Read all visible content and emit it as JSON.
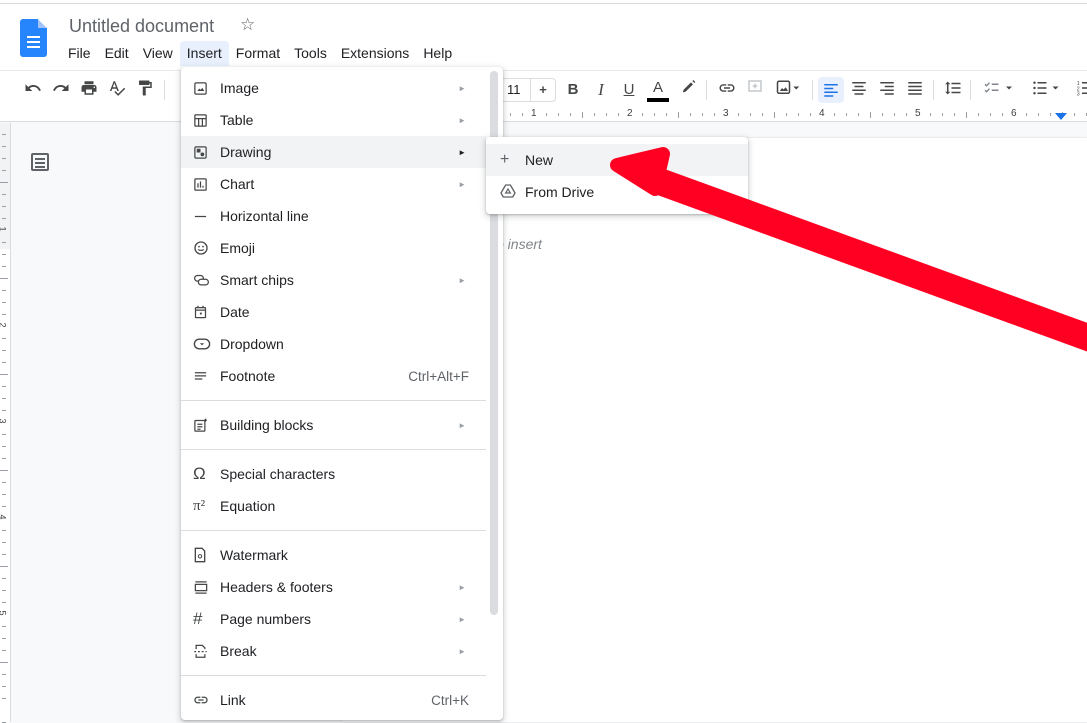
{
  "document": {
    "title": "Untitled document",
    "placeholder_fragment": "o insert"
  },
  "menubar": [
    "File",
    "Edit",
    "View",
    "Insert",
    "Format",
    "Tools",
    "Extensions",
    "Help"
  ],
  "toolbar": {
    "font_size": "11",
    "font_size_increase": "+",
    "bold": "B",
    "italic": "I",
    "underline": "U",
    "text_color": "A",
    "accent_color": "#1a73e8"
  },
  "ruler": {
    "horizontal_numbers": [
      "1",
      "2",
      "3",
      "4",
      "5",
      "6"
    ],
    "vertical_numbers": [
      "1",
      "2",
      "3",
      "4",
      "5"
    ]
  },
  "insert_menu": {
    "items": [
      {
        "label": "Image",
        "icon": "image-icon",
        "submenu": true
      },
      {
        "label": "Table",
        "icon": "table-icon",
        "submenu": true
      },
      {
        "label": "Drawing",
        "icon": "drawing-icon",
        "submenu": true,
        "highlighted": true
      },
      {
        "label": "Chart",
        "icon": "chart-icon",
        "submenu": true
      },
      {
        "label": "Horizontal line",
        "icon": "horizontal-line-icon"
      },
      {
        "label": "Emoji",
        "icon": "emoji-icon"
      },
      {
        "label": "Smart chips",
        "icon": "smart-chips-icon",
        "submenu": true
      },
      {
        "label": "Date",
        "icon": "date-icon"
      },
      {
        "label": "Dropdown",
        "icon": "dropdown-icon"
      },
      {
        "label": "Footnote",
        "icon": "footnote-icon",
        "shortcut": "Ctrl+Alt+F"
      },
      {
        "label": "Building blocks",
        "icon": "building-blocks-icon",
        "submenu": true
      },
      {
        "label": "Special characters",
        "icon": "omega-icon"
      },
      {
        "label": "Equation",
        "icon": "pi-icon"
      },
      {
        "label": "Watermark",
        "icon": "watermark-icon"
      },
      {
        "label": "Headers & footers",
        "icon": "headers-footers-icon",
        "submenu": true
      },
      {
        "label": "Page numbers",
        "icon": "hash-icon",
        "submenu": true
      },
      {
        "label": "Break",
        "icon": "break-icon",
        "submenu": true
      },
      {
        "label": "Link",
        "icon": "link-icon",
        "shortcut": "Ctrl+K"
      }
    ]
  },
  "drawing_submenu": {
    "items": [
      {
        "label": "New",
        "icon": "plus-icon",
        "highlighted": true
      },
      {
        "label": "From Drive",
        "icon": "drive-icon"
      }
    ]
  },
  "annotation": {
    "type": "arrow",
    "color": "#ff0022",
    "points_to": "New"
  },
  "glyphs": {
    "star": "☆",
    "submenu_arrow": "►",
    "plus": "+",
    "omega": "Ω",
    "pi": "π²",
    "hash": "#",
    "dash": "—"
  }
}
